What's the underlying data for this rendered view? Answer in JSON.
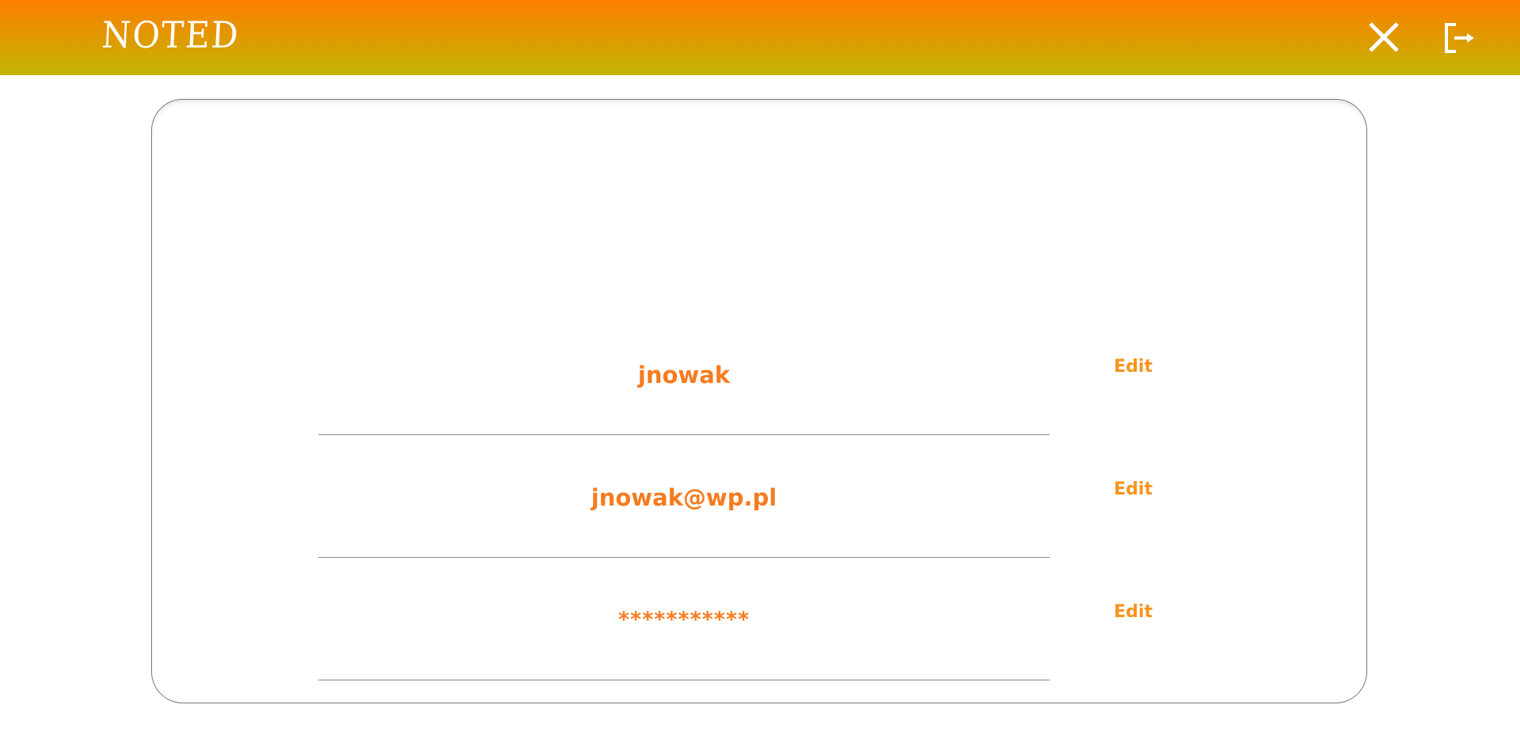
{
  "header": {
    "logo_text": "NOTED",
    "close_icon": "close-icon",
    "logout_icon": "logout-icon",
    "gradient_top": "#fd7e00",
    "gradient_bottom": "#c2b500"
  },
  "profile": {
    "accent": "#f57c1f",
    "fields": [
      {
        "value": "jnowak",
        "edit_label": "Edit"
      },
      {
        "value": "jnowak@wp.pl",
        "edit_label": "Edit"
      },
      {
        "value": "***********",
        "edit_label": "Edit"
      }
    ]
  }
}
